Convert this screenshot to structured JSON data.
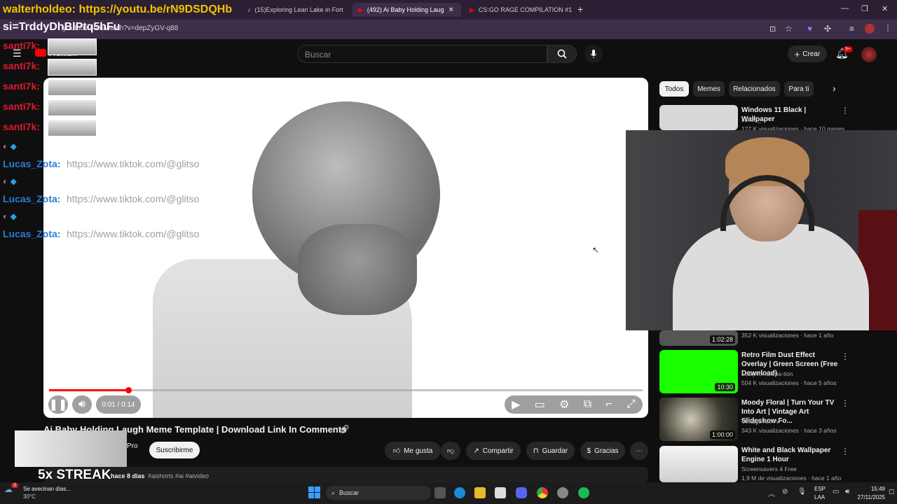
{
  "overlay_top": {
    "line1": "walterholdeo: https://youtu.be/rN9DSDQHb",
    "line2": "si=TrddyDhBlPtq5hFu"
  },
  "tabs": [
    {
      "label": "(15)Exploring Lean Lake in Fort"
    },
    {
      "label": "(492) Ai Baby Holding Laug"
    },
    {
      "label": "CS:GO RAGE COMPILATION #1"
    }
  ],
  "address": {
    "url": "youtube.com/watch?v=depZyGV-q88"
  },
  "header": {
    "search_placeholder": "Buscar",
    "create_label": "Crear",
    "notif_count": "9+",
    "logo_text": "Premium"
  },
  "chat": {
    "red_user": "santi7k:",
    "blue_user": "Lucas_Zota:",
    "blue_link": "https://www.tiktok.com/@glitso"
  },
  "player": {
    "time": "0:01 / 0:14",
    "progress_fraction": 0.133
  },
  "video": {
    "title": "Ai Baby Holding Laugh Meme Template | Download Link In Comments",
    "channel_suffix": "Pro",
    "subscribe": "Subscribe",
    "subscribe_label": "Suscribirme",
    "like": "Me gusta",
    "share": "Compartir",
    "save": "Guardar",
    "thanks": "Gracias",
    "desc_date": "hace 8 días",
    "desc_tags": "#aishorts #ai #aivideo",
    "desc_views": "3"
  },
  "overlay_streak": "5x STREAK",
  "chips": [
    "Todos",
    "Memes",
    "Relacionados",
    "Para ti"
  ],
  "recs": [
    {
      "title": "Windows 11 Black | Wallpaper",
      "channel": "z3n28_",
      "meta": "127 K visualizaciones · hace 10 meses",
      "duration": ""
    },
    {
      "title": "",
      "channel": "",
      "meta": "352 K visualizaciones · hace 1 año",
      "duration": "1:02:28"
    },
    {
      "title": "Retro Film Dust Effect Overlay | Green Screen (Free Download)",
      "channel": "scarpvfx anima-tion",
      "meta": "504 K visualizaciones · hace 5 años",
      "duration": "10:30"
    },
    {
      "title": "Moody Floral | Turn Your TV Into Art | Vintage Art Slideshow Fo...",
      "channel": "Vintage Art TV",
      "meta": "343 K visualizaciones · hace 3 años",
      "duration": "1:00:00"
    },
    {
      "title": "White and Black Wallpaper Engine 1 Hour",
      "channel": "Screensavers 4 Free",
      "meta": "1,9 M de visualizaciones · hace 1 año",
      "duration": ""
    }
  ],
  "taskbar": {
    "weather_title": "Se avecinan días...",
    "weather_temp": "30°C",
    "search": "Buscar",
    "lang1": "ESP",
    "lang2": "LAA",
    "time": "15:49",
    "date": "27/11/2025",
    "badge": "3"
  },
  "colors": {
    "accent": "#ff0000",
    "bg": "#0f0f0f",
    "green": "#1aff00"
  }
}
